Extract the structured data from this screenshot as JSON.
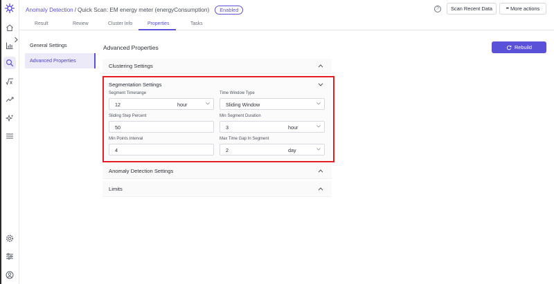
{
  "header": {
    "breadcrumb_link": "Anomaly Detection",
    "separator": "/",
    "breadcrumb_current": "Quick Scan: EM energy meter (energyConsumption)",
    "status_badge": "Enabled",
    "help_label": "?",
    "scan_button": "Scan Recent Data",
    "more_actions_button": "More actions",
    "more_actions_prefix": "•••"
  },
  "tabs": [
    "Result",
    "Review",
    "Cluster Info",
    "Properties",
    "Tasks"
  ],
  "active_tab": "Properties",
  "settings_nav": [
    "General Settings",
    "Advanced Properties"
  ],
  "active_settings_nav": "Advanced Properties",
  "main": {
    "title": "Advanced Properties",
    "rebuild_button": "Rebuild"
  },
  "sections": {
    "clustering": "Clustering Settings",
    "segmentation": "Segmentation Settings",
    "anomaly_detection": "Anomaly Detection Settings",
    "limits": "Limits"
  },
  "segmentation_fields": {
    "segment_timerange": {
      "label": "Segment Timerange",
      "value": "12",
      "unit": "hour"
    },
    "time_window_type": {
      "label": "Time Window Type",
      "value": "Sliding Window"
    },
    "sliding_step_percent": {
      "label": "Sliding Step Percent",
      "value": "50"
    },
    "min_segment_duration": {
      "label": "Min Segment Duration",
      "value": "3",
      "unit": "hour"
    },
    "min_points_interval": {
      "label": "Min Points Interval",
      "value": "4"
    },
    "max_time_gap": {
      "label": "Max Time Gap In Segment",
      "value": "2",
      "unit": "day"
    }
  },
  "rail_icons": [
    "app-logo-icon",
    "home-icon",
    "chart-icon",
    "search-icon",
    "function-icon",
    "trend-icon",
    "sparkle-icon",
    "menu-icon",
    "settings-icon",
    "filters-icon",
    "user-icon"
  ],
  "colors": {
    "accent": "#5b51d8",
    "highlight": "#e51d23"
  }
}
